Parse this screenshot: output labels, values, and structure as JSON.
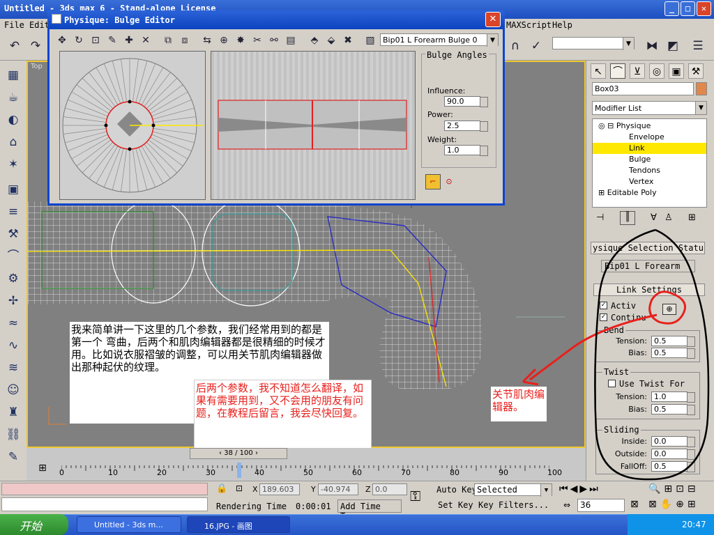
{
  "window": {
    "title": "Untitled - 3ds max 6 - Stand-alone License"
  },
  "menu": {
    "file": "File",
    "edit": "Edit",
    "maxscript": "MAXScript",
    "help": "Help"
  },
  "viewport": {
    "label": "Top"
  },
  "timeline": {
    "frame_counter": "38 / 100",
    "ticks": [
      "0",
      "10",
      "20",
      "30",
      "40",
      "50",
      "60",
      "70",
      "80",
      "90",
      "100"
    ]
  },
  "status": {
    "x_label": "X",
    "x_value": "189.603",
    "y_label": "Y",
    "y_value": "-40.974",
    "z_label": "Z",
    "z_value": "0.0",
    "rendering_time_label": "Rendering Time",
    "rendering_time": "0:00:01",
    "add_time_tag": "Add Time Tag",
    "auto_key": "Auto Key",
    "set_key": "Set Key",
    "selected": "Selected",
    "key_filters": "Key Filters...",
    "current_frame": "36"
  },
  "taskbar": {
    "start": "开始",
    "task1": "Untitled - 3ds m...",
    "task2": "16.JPG - 画图",
    "clock": "20:47"
  },
  "command_panel": {
    "object_name": "Box03",
    "object_color": "#e0884c",
    "modifier_list": "Modifier List",
    "stack": [
      {
        "label": "Physique",
        "selected": false
      },
      {
        "label": "Envelope",
        "selected": false
      },
      {
        "label": "Link",
        "selected": true
      },
      {
        "label": "Bulge",
        "selected": false
      },
      {
        "label": "Tendons",
        "selected": false
      },
      {
        "label": "Vertex",
        "selected": false
      },
      {
        "label": "Editable Poly",
        "selected": false
      }
    ],
    "rollout_physique_title": "ysique Selection Statu",
    "selected_link": "Bip01 L Forearm",
    "link_settings_title": "Link Settings",
    "active_label": "Activ",
    "continuity_label": "Continu",
    "bend_title": "Bend",
    "bend_tension_label": "Tension:",
    "bend_tension": "0.5",
    "bend_bias_label": "Bias:",
    "bend_bias": "0.5",
    "twist_title": "Twist",
    "use_twist_label": "Use Twist For",
    "twist_tension_label": "Tension:",
    "twist_tension": "1.0",
    "twist_bias_label": "Bias:",
    "twist_bias": "0.5",
    "sliding_title": "Sliding",
    "inside_label": "Inside:",
    "inside": "0.0",
    "outside_label": "Outside:",
    "outside": "0.0",
    "falloff_label": "FallOff:",
    "falloff": "0.5"
  },
  "bulge_editor": {
    "title": "Physique: Bulge Editor",
    "cross_section": "Bip01 L Forearm Bulge 0",
    "angles_title": "Bulge Angles",
    "influence_label": "Influence:",
    "influence": "90.0",
    "power_label": "Power:",
    "power": "2.5",
    "weight_label": "Weight:",
    "weight": "1.0"
  },
  "annotations": {
    "note_main": "我来简单讲一下这里的几个参数，我们经常用到的都是第一个 弯曲，后两个和肌肉编辑器都是很精细的时候才用。比如说衣服褶皱的调整，可以用关节肌肉编辑器做出那种起伏的纹理。",
    "note_red": "后两个参数，我不知道怎么翻译，如果有需要用到，又不会用的朋友有问题，在教程后留言，我会尽快回复。",
    "note_joint": "关节肌肉编辑器。"
  },
  "colors": {
    "annotation_red": "#e8201c",
    "selection_yellow": "#ffe800",
    "titlebar_blue": "#1d4fc0"
  }
}
